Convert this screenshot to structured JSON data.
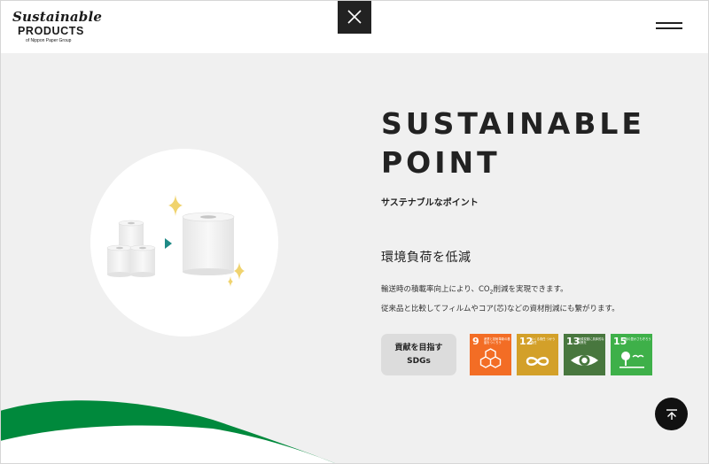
{
  "header": {
    "logo": {
      "script": "Sustainable",
      "main": "PRODUCTS",
      "sub": "of Nippon Paper Group"
    },
    "close_icon": "close-icon",
    "menu_icon": "hamburger-menu-icon"
  },
  "main": {
    "title_line1": "SUSTAINABLE",
    "title_line2": "POINT",
    "subtitle": "サステナブルなポイント",
    "heading": "環境負荷を低減",
    "desc_line1_a": "輸送時の積載率向上により、CO",
    "desc_line1_sub": "2",
    "desc_line1_b": "削減を実現できます。",
    "desc_line2": "従来品と比較してフィルムやコア(芯)などの資材削減にも繋がります。",
    "contribution_line1": "貢献を目指す",
    "contribution_line2": "SDGs"
  },
  "sdgs": [
    {
      "number": "9",
      "text": "産業と技術革新の基盤をつくろう",
      "color": "#f36d25"
    },
    {
      "number": "12",
      "text": "つくる責任 つかう責任",
      "color": "#d3a029"
    },
    {
      "number": "13",
      "text": "気候変動に具体的な対策を",
      "color": "#48773e"
    },
    {
      "number": "15",
      "text": "陸の豊かさも守ろう",
      "color": "#3eb049"
    }
  ],
  "colors": {
    "background": "#f0f0f0",
    "accent_green": "#00893c",
    "arrow_teal": "#1f8a86",
    "sparkle": "#f0d36e"
  },
  "back_to_top_icon": "arrow-up-icon"
}
